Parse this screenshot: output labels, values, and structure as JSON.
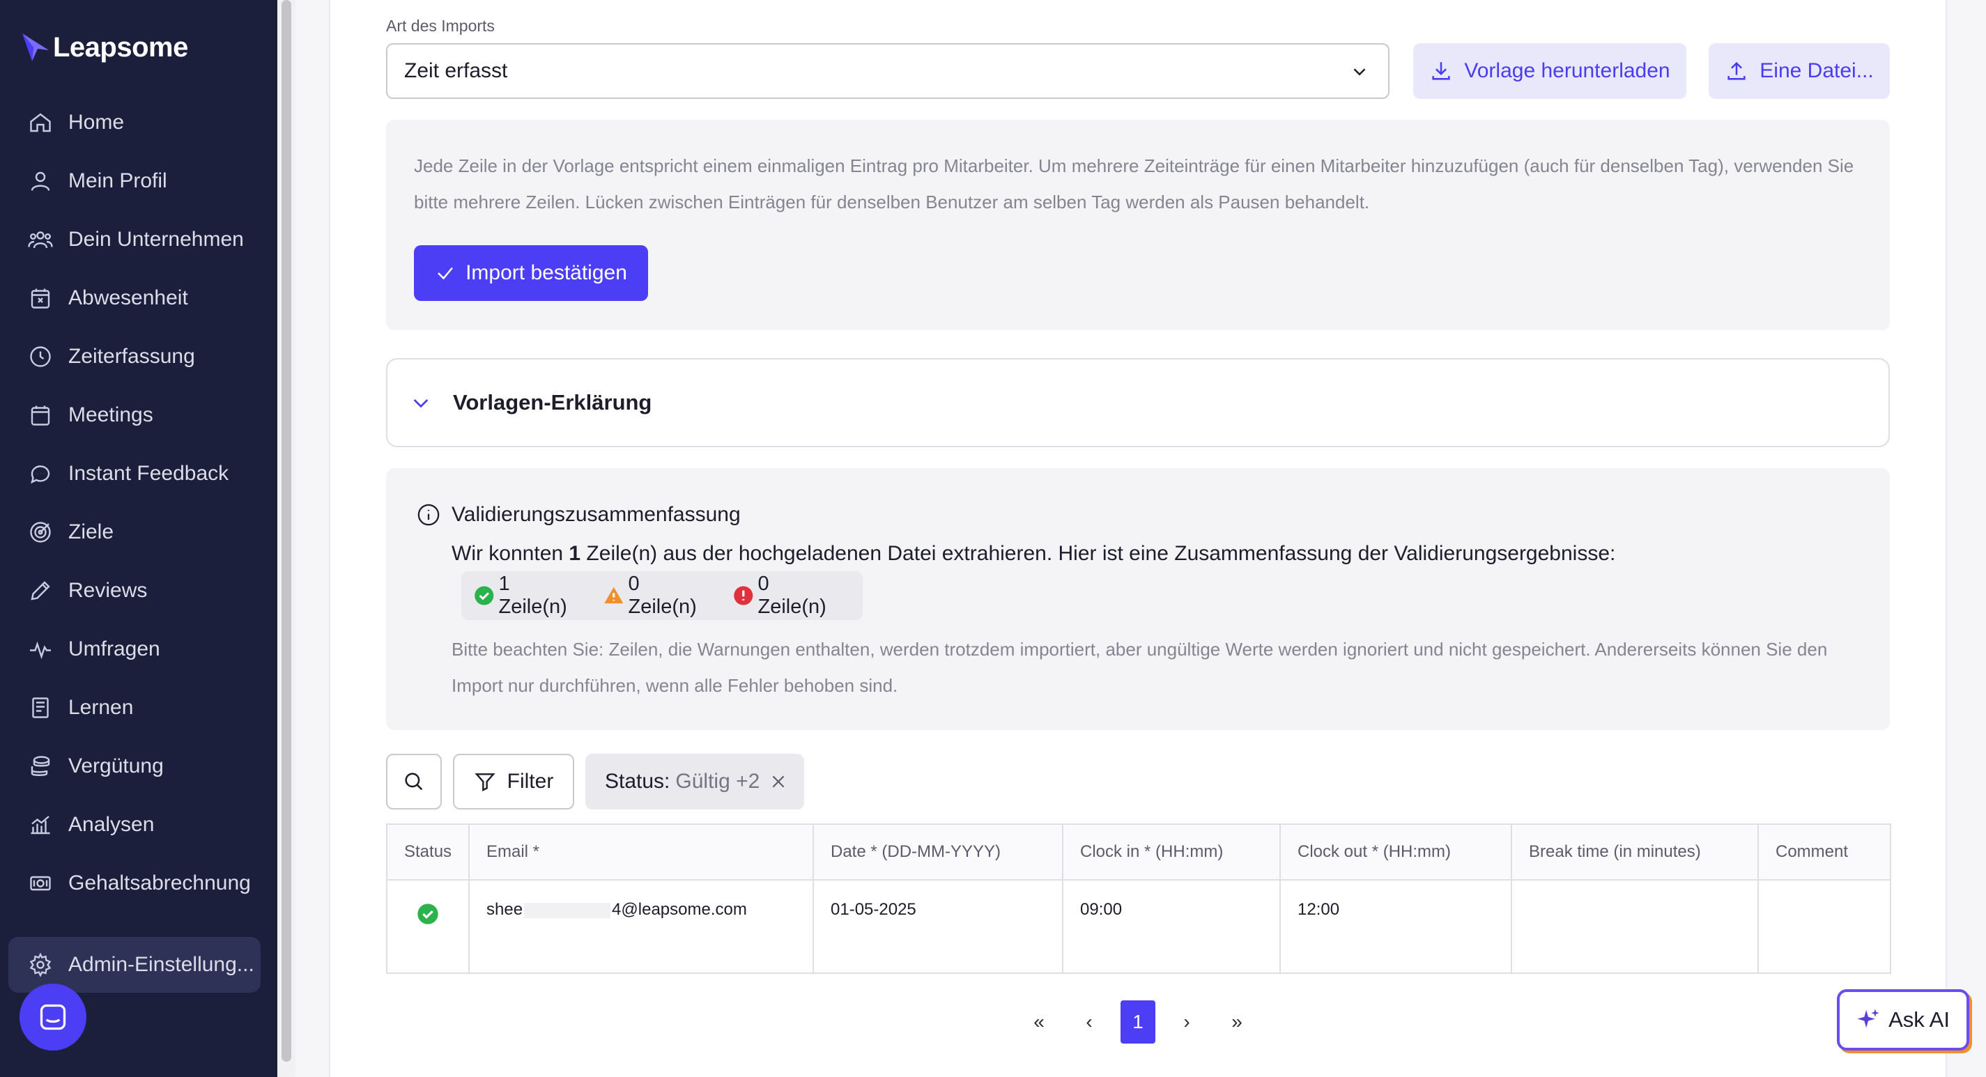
{
  "brand": {
    "name": "Leapsome",
    "color": "#4c3ef5"
  },
  "sidebar": {
    "items": [
      {
        "label": "Home",
        "icon": "home-icon"
      },
      {
        "label": "Mein Profil",
        "icon": "user-icon"
      },
      {
        "label": "Dein Unternehmen",
        "icon": "users-icon"
      },
      {
        "label": "Abwesenheit",
        "icon": "calendar-x-icon"
      },
      {
        "label": "Zeiterfassung",
        "icon": "clock-icon"
      },
      {
        "label": "Meetings",
        "icon": "calendar-icon"
      },
      {
        "label": "Instant Feedback",
        "icon": "chat-icon"
      },
      {
        "label": "Ziele",
        "icon": "target-icon"
      },
      {
        "label": "Reviews",
        "icon": "pen-icon"
      },
      {
        "label": "Umfragen",
        "icon": "pulse-icon"
      },
      {
        "label": "Lernen",
        "icon": "book-icon"
      },
      {
        "label": "Vergütung",
        "icon": "coins-icon"
      },
      {
        "label": "Analysen",
        "icon": "chart-icon"
      },
      {
        "label": "Gehaltsabrechnung",
        "icon": "money-icon"
      }
    ],
    "admin": {
      "label": "Admin-Einstellung...",
      "icon": "gear-icon"
    }
  },
  "import_form": {
    "type_label": "Art des Imports",
    "type_value": "Zeit erfasst",
    "download_template": "Vorlage herunterladen",
    "upload_file": "Eine Datei..."
  },
  "info": {
    "text": "Jede Zeile in der Vorlage entspricht einem einmaligen Eintrag pro Mitarbeiter. Um mehrere Zeiteinträge für einen Mitarbeiter hinzuzufügen (auch für denselben Tag), verwenden Sie bitte mehrere Zeilen. Lücken zwischen Einträgen für denselben Benutzer am selben Tag werden als Pausen behandelt.",
    "confirm_button": "Import bestätigen"
  },
  "accordion": {
    "title": "Vorlagen-Erklärung"
  },
  "validation": {
    "title": "Validierungszusammenfassung",
    "summary_prefix": "Wir konnten ",
    "summary_count": "1",
    "summary_suffix": " Zeile(n) aus der hochgeladenen Datei extrahieren. Hier ist eine Zusammenfassung der Validierungsergebnisse:",
    "valid": "1 Zeile(n)",
    "warnings": "0 Zeile(n)",
    "errors": "0 Zeile(n)",
    "note": "Bitte beachten Sie: Zeilen, die Warnungen enthalten, werden trotzdem importiert, aber ungültige Werte werden ignoriert und nicht gespeichert. Andererseits können Sie den Import nur durchführen, wenn alle Fehler behoben sind."
  },
  "toolbar": {
    "filter_label": "Filter",
    "status_label": "Status:",
    "status_value": "Gültig +2"
  },
  "table": {
    "headers": [
      "Status",
      "Email *",
      "Date * (DD-MM-YYYY)",
      "Clock in * (HH:mm)",
      "Clock out * (HH:mm)",
      "Break time (in minutes)",
      "Comment"
    ],
    "rows": [
      {
        "status": "valid",
        "email_start": "shee",
        "email_end": "4@leapsome.com",
        "date": "01-05-2025",
        "clock_in": "09:00",
        "clock_out": "12:00",
        "break": "",
        "comment": ""
      }
    ]
  },
  "pagination": {
    "first": "«",
    "prev": "‹",
    "current": "1",
    "next": "›",
    "last": "»"
  },
  "ask_ai": {
    "label": "Ask AI"
  },
  "colors": {
    "accent": "#4c3ef5",
    "sidebar_bg": "#1c1f3b",
    "success": "#2bb24c",
    "warning": "#f0902a",
    "error": "#e0323c"
  }
}
